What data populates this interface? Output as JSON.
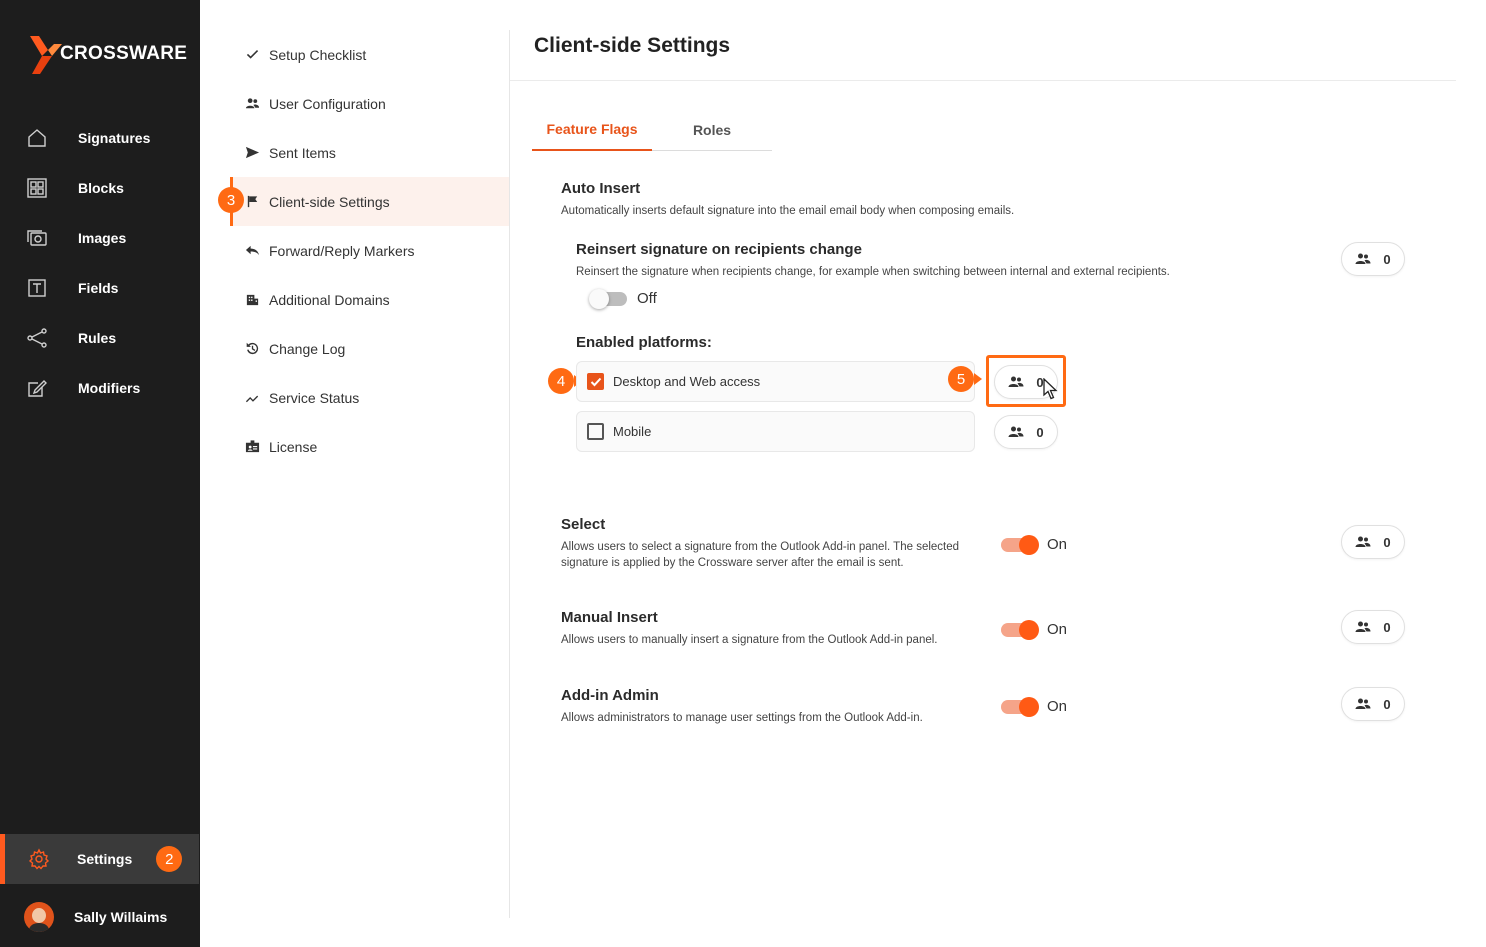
{
  "app": {
    "logo_text": "CROSSWARE"
  },
  "sidebar": {
    "items": [
      {
        "label": "Signatures",
        "icon": "home-icon"
      },
      {
        "label": "Blocks",
        "icon": "blocks-icon"
      },
      {
        "label": "Images",
        "icon": "images-icon"
      },
      {
        "label": "Fields",
        "icon": "fields-icon"
      },
      {
        "label": "Rules",
        "icon": "rules-icon"
      },
      {
        "label": "Modifiers",
        "icon": "modifiers-icon"
      }
    ],
    "settings": {
      "label": "Settings",
      "icon": "gear-icon",
      "badge": "2"
    },
    "user": {
      "name": "Sally Willaims"
    }
  },
  "submenu": {
    "items": [
      {
        "label": "Setup Checklist",
        "icon": "check-icon"
      },
      {
        "label": "User Configuration",
        "icon": "users-icon"
      },
      {
        "label": "Sent Items",
        "icon": "send-icon"
      },
      {
        "label": "Client-side Settings",
        "icon": "flag-icon",
        "badge": "3"
      },
      {
        "label": "Forward/Reply Markers",
        "icon": "reply-icon"
      },
      {
        "label": "Additional Domains",
        "icon": "building-icon"
      },
      {
        "label": "Change Log",
        "icon": "history-icon"
      },
      {
        "label": "Service Status",
        "icon": "trend-icon"
      },
      {
        "label": "License",
        "icon": "badge-id-icon"
      }
    ]
  },
  "main": {
    "title": "Client-side Settings",
    "tabs": [
      {
        "label": "Feature Flags"
      },
      {
        "label": "Roles"
      }
    ],
    "auto_insert": {
      "title": "Auto Insert",
      "description": "Automatically inserts default signature into the email email body when composing emails.",
      "reinsert": {
        "title": "Reinsert signature on recipients change",
        "description": "Reinsert the signature when recipients change, for example when switching between internal and external recipients.",
        "toggle_label": "Off",
        "count": "0"
      },
      "platforms_label": "Enabled platforms:",
      "platforms": [
        {
          "label": "Desktop and Web access",
          "checked": true,
          "count": "0",
          "step": "4",
          "count_step": "5"
        },
        {
          "label": "Mobile",
          "checked": false,
          "count": "0"
        }
      ]
    },
    "select": {
      "title": "Select",
      "description_line1": "Allows users to select a signature from the Outlook Add-in panel. The selected",
      "description_line2": "signature is applied by the Crossware server after the email is sent.",
      "toggle_label": "On",
      "count": "0"
    },
    "manual_insert": {
      "title": "Manual Insert",
      "description": "Allows users to manually insert a signature from the Outlook Add-in panel.",
      "toggle_label": "On",
      "count": "0"
    },
    "addin_admin": {
      "title": "Add-in Admin",
      "description": "Allows administrators to manage user settings from the Outlook Add-in.",
      "toggle_label": "On",
      "count": "0"
    }
  },
  "colors": {
    "accent": "#ff6a13",
    "sidebar_bg": "#1d1d1d",
    "active_tab": "#e8541a"
  }
}
